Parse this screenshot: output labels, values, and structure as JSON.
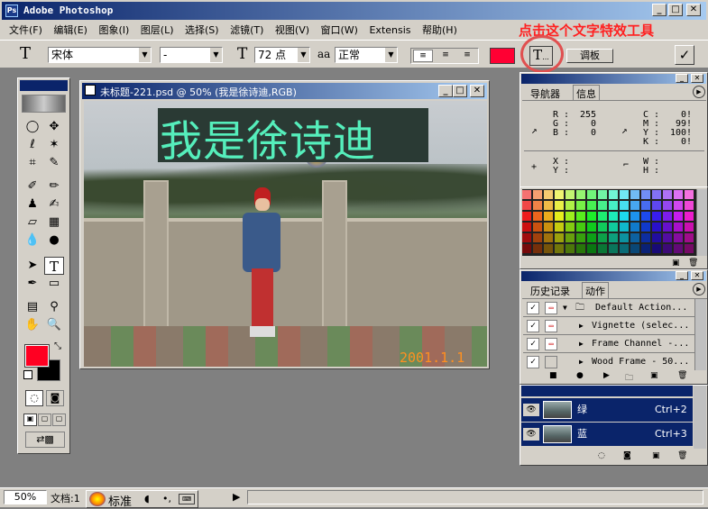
{
  "app": {
    "title": "Adobe Photoshop"
  },
  "menu": [
    "文件(F)",
    "编辑(E)",
    "图象(I)",
    "图层(L)",
    "选择(S)",
    "滤镜(T)",
    "视图(V)",
    "窗口(W)",
    "Extensis",
    "帮助(H)"
  ],
  "annotation": {
    "text": "点击这个文字特效工具",
    "color": "#ff2020"
  },
  "options": {
    "tool_glyph": "T",
    "font": "宋体",
    "style": "-",
    "size_glyph": "T",
    "size": "72 点",
    "aa_label": "aa",
    "aa_value": "正常",
    "color": "#ff0033",
    "warp_glyph": "T",
    "palette_button": "调板",
    "commit_glyph": "✓"
  },
  "document": {
    "title": "未标题-221.psd @ 50% (我是徐诗迪,RGB)",
    "text_layer": "我是徐诗迪",
    "text_color": "#55eebb",
    "date_stamp": "2001.1.1"
  },
  "info_panel": {
    "tabs": [
      "导航器",
      "信息"
    ],
    "rgb_labels": [
      "R :",
      "G :",
      "B :"
    ],
    "rgb_values": [
      "255",
      "0",
      "0"
    ],
    "cmyk_labels": [
      "C :",
      "M :",
      "Y :",
      "K :"
    ],
    "cmyk_values": [
      "0!",
      "99!",
      "100!",
      "0!"
    ],
    "xy_labels": [
      "X :",
      "Y :"
    ],
    "wh_labels": [
      "W :",
      "H :"
    ]
  },
  "actions_panel": {
    "tabs": [
      "历史记录",
      "动作"
    ],
    "rows": [
      {
        "label": "Default Action..."
      },
      {
        "label": "Vignette (selec..."
      },
      {
        "label": "Frame Channel -..."
      },
      {
        "label": "Wood Frame - 50..."
      }
    ]
  },
  "layers_panel": {
    "rows": [
      {
        "name": "绿",
        "shortcut": "Ctrl+2"
      },
      {
        "name": "蓝",
        "shortcut": "Ctrl+3"
      }
    ]
  },
  "status": {
    "zoom": "50%",
    "doc_label": "文档:1",
    "taskbar_label": "标准"
  },
  "tools": {
    "fg_color": "#ff0022",
    "bg_color": "#000000"
  }
}
